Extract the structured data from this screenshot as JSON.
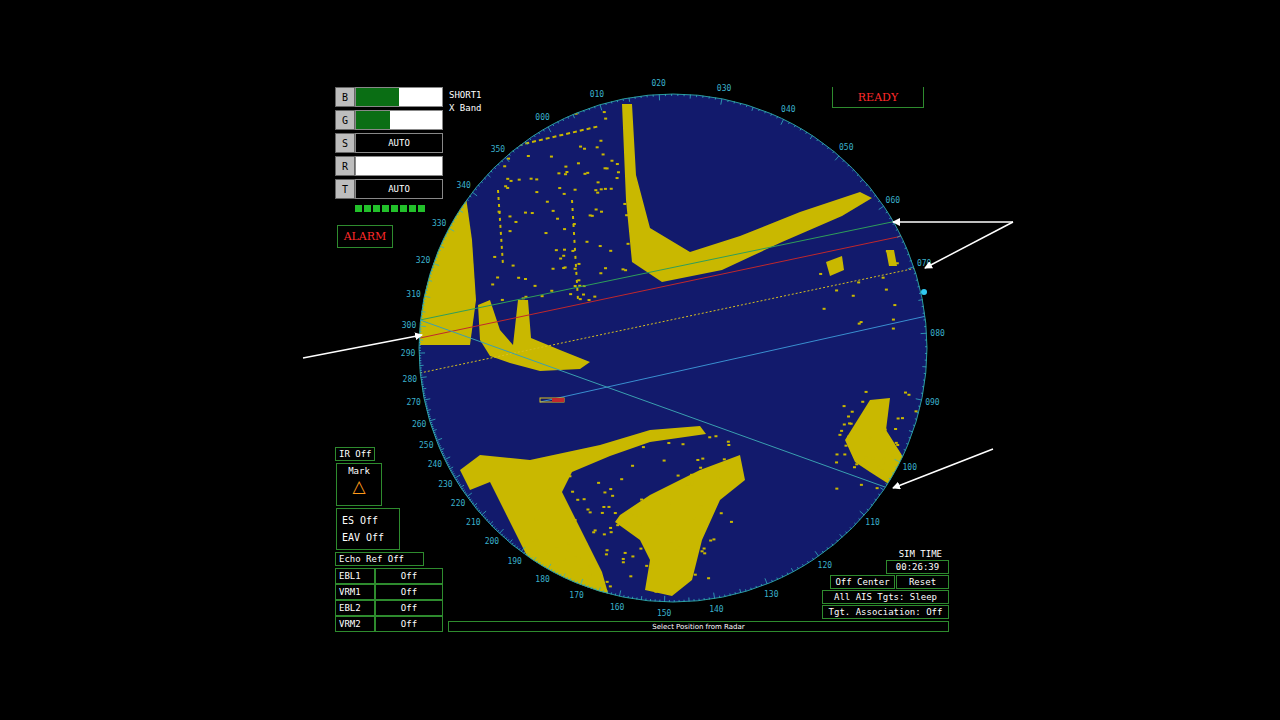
{
  "range": {
    "scale": "SHORT1",
    "band": "X Band"
  },
  "controls": [
    {
      "label": "B",
      "kind": "bar",
      "level": 0.5
    },
    {
      "label": "G",
      "kind": "bar",
      "level": 0.4
    },
    {
      "label": "S",
      "kind": "value",
      "value": "AUTO"
    },
    {
      "label": "R",
      "kind": "bar",
      "level": 0
    },
    {
      "label": "T",
      "kind": "value",
      "value": "AUTO"
    }
  ],
  "signal": {
    "segments": 8,
    "lit": 8
  },
  "alarm": "ALARM",
  "status": "READY",
  "toggles": {
    "ir": "IR Off",
    "mark": {
      "label": "Mark",
      "icon": "△"
    },
    "es": "ES Off",
    "eav": "EAV Off",
    "echo_ref": "Echo Ref Off"
  },
  "lines_table": [
    {
      "name": "EBL1",
      "value": "Off"
    },
    {
      "name": "VRM1",
      "value": "Off"
    },
    {
      "name": "EBL2",
      "value": "Off"
    },
    {
      "name": "VRM2",
      "value": "Off"
    }
  ],
  "sim_time": {
    "label": "SIM TIME",
    "value": "00:26:39"
  },
  "buttons": [
    "Off Center",
    "Reset"
  ],
  "ais": "All AIS Tgts: Sleep",
  "association": "Tgt. Association: Off",
  "status_bar": "Select Position from Radar",
  "bearings": [
    "000",
    "010",
    "020",
    "030",
    "040",
    "050",
    "060",
    "070",
    "080",
    "090",
    "100",
    "110",
    "120",
    "130",
    "140",
    "150",
    "160",
    "170",
    "180",
    "190",
    "200",
    "210",
    "220",
    "230",
    "240",
    "250",
    "260",
    "270",
    "280",
    "290",
    "300",
    "310",
    "320",
    "330",
    "340",
    "350"
  ]
}
